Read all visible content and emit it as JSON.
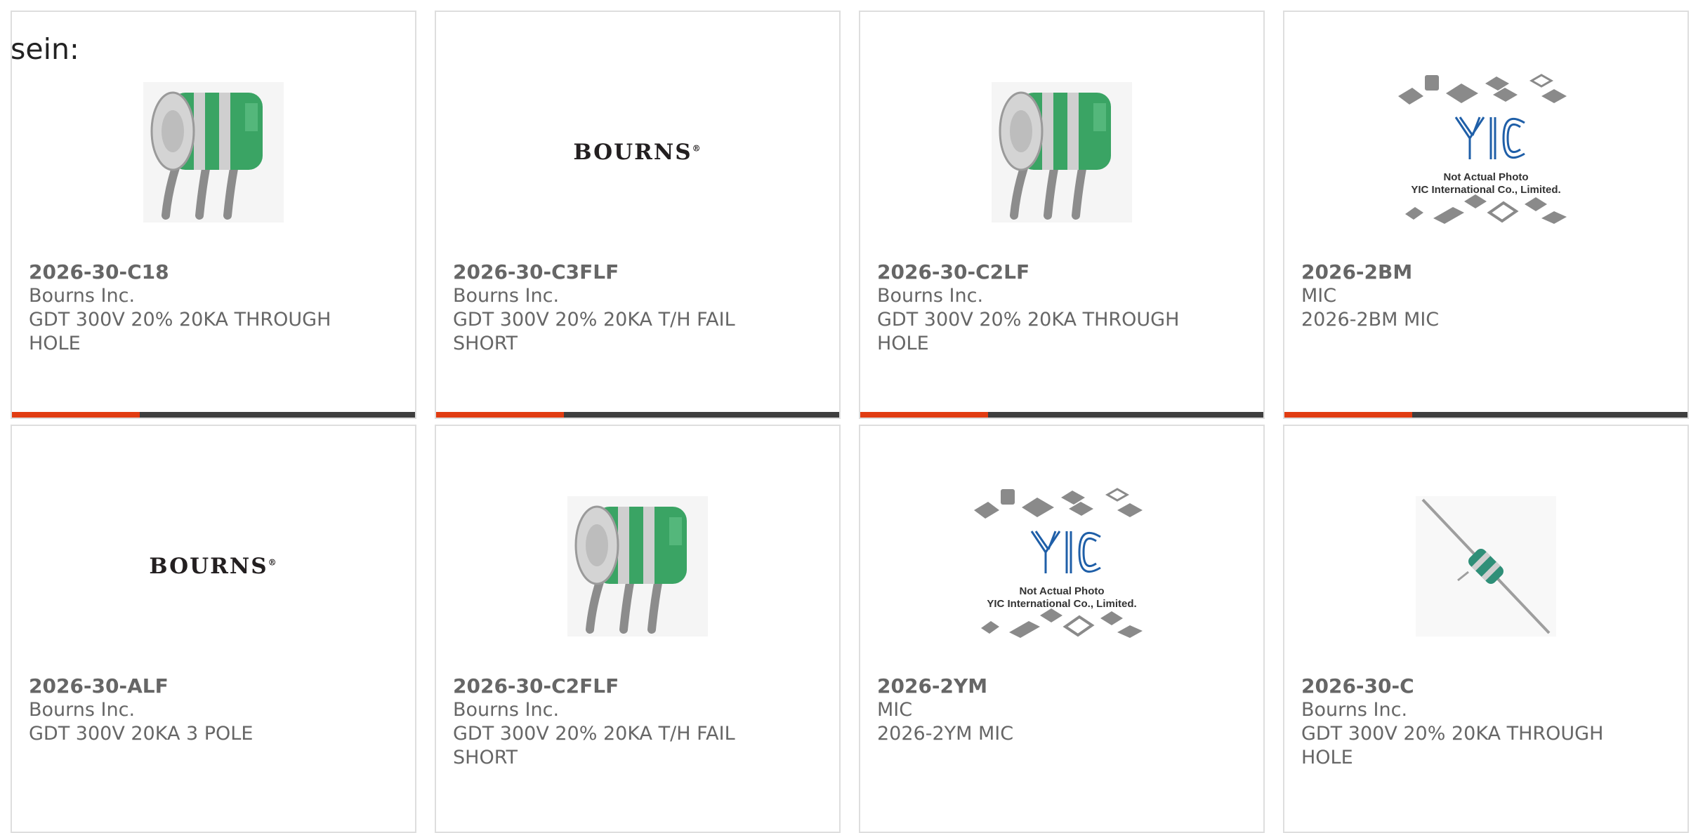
{
  "prefix_text": "sein:",
  "accent_color": "#e13c12",
  "bar_color": "#3e3e3e",
  "products": [
    {
      "part_number": "2026-30-C18",
      "manufacturer": "Bourns Inc.",
      "desc1": "GDT 300V 20% 20KA THROUGH",
      "desc2": "HOLE",
      "image": "gdt-3pole-photo",
      "has_bar": true
    },
    {
      "part_number": "2026-30-C3FLF",
      "manufacturer": "Bourns Inc.",
      "desc1": "GDT 300V 20% 20KA T/H FAIL",
      "desc2": "SHORT",
      "image": "bourns-logo",
      "has_bar": true
    },
    {
      "part_number": "2026-30-C2LF",
      "manufacturer": "Bourns Inc.",
      "desc1": "GDT 300V 20% 20KA THROUGH",
      "desc2": "HOLE",
      "image": "gdt-3pole-photo",
      "has_bar": true
    },
    {
      "part_number": "2026-2BM",
      "manufacturer": "MIC",
      "desc1": "2026-2BM MIC",
      "desc2": "",
      "image": "yic-placeholder",
      "has_bar": true
    },
    {
      "part_number": "2026-30-ALF",
      "manufacturer": "Bourns Inc.",
      "desc1": "GDT 300V 20KA 3 POLE",
      "desc2": "",
      "image": "bourns-logo",
      "has_bar": false
    },
    {
      "part_number": "2026-30-C2FLF",
      "manufacturer": "Bourns Inc.",
      "desc1": "GDT 300V 20% 20KA T/H FAIL",
      "desc2": "SHORT",
      "image": "gdt-3pole-photo",
      "has_bar": false
    },
    {
      "part_number": "2026-2YM",
      "manufacturer": "MIC",
      "desc1": "2026-2YM MIC",
      "desc2": "",
      "image": "yic-placeholder",
      "has_bar": false
    },
    {
      "part_number": "2026-30-C",
      "manufacturer": "Bourns Inc.",
      "desc1": "GDT 300V 20% 20KA THROUGH",
      "desc2": "HOLE",
      "image": "gdt-axial-photo",
      "has_bar": false
    }
  ],
  "logos": {
    "bourns": "BOURNS",
    "yic_caption_1": "Not Actual Photo",
    "yic_caption_2": "YIC International Co., Limited."
  }
}
